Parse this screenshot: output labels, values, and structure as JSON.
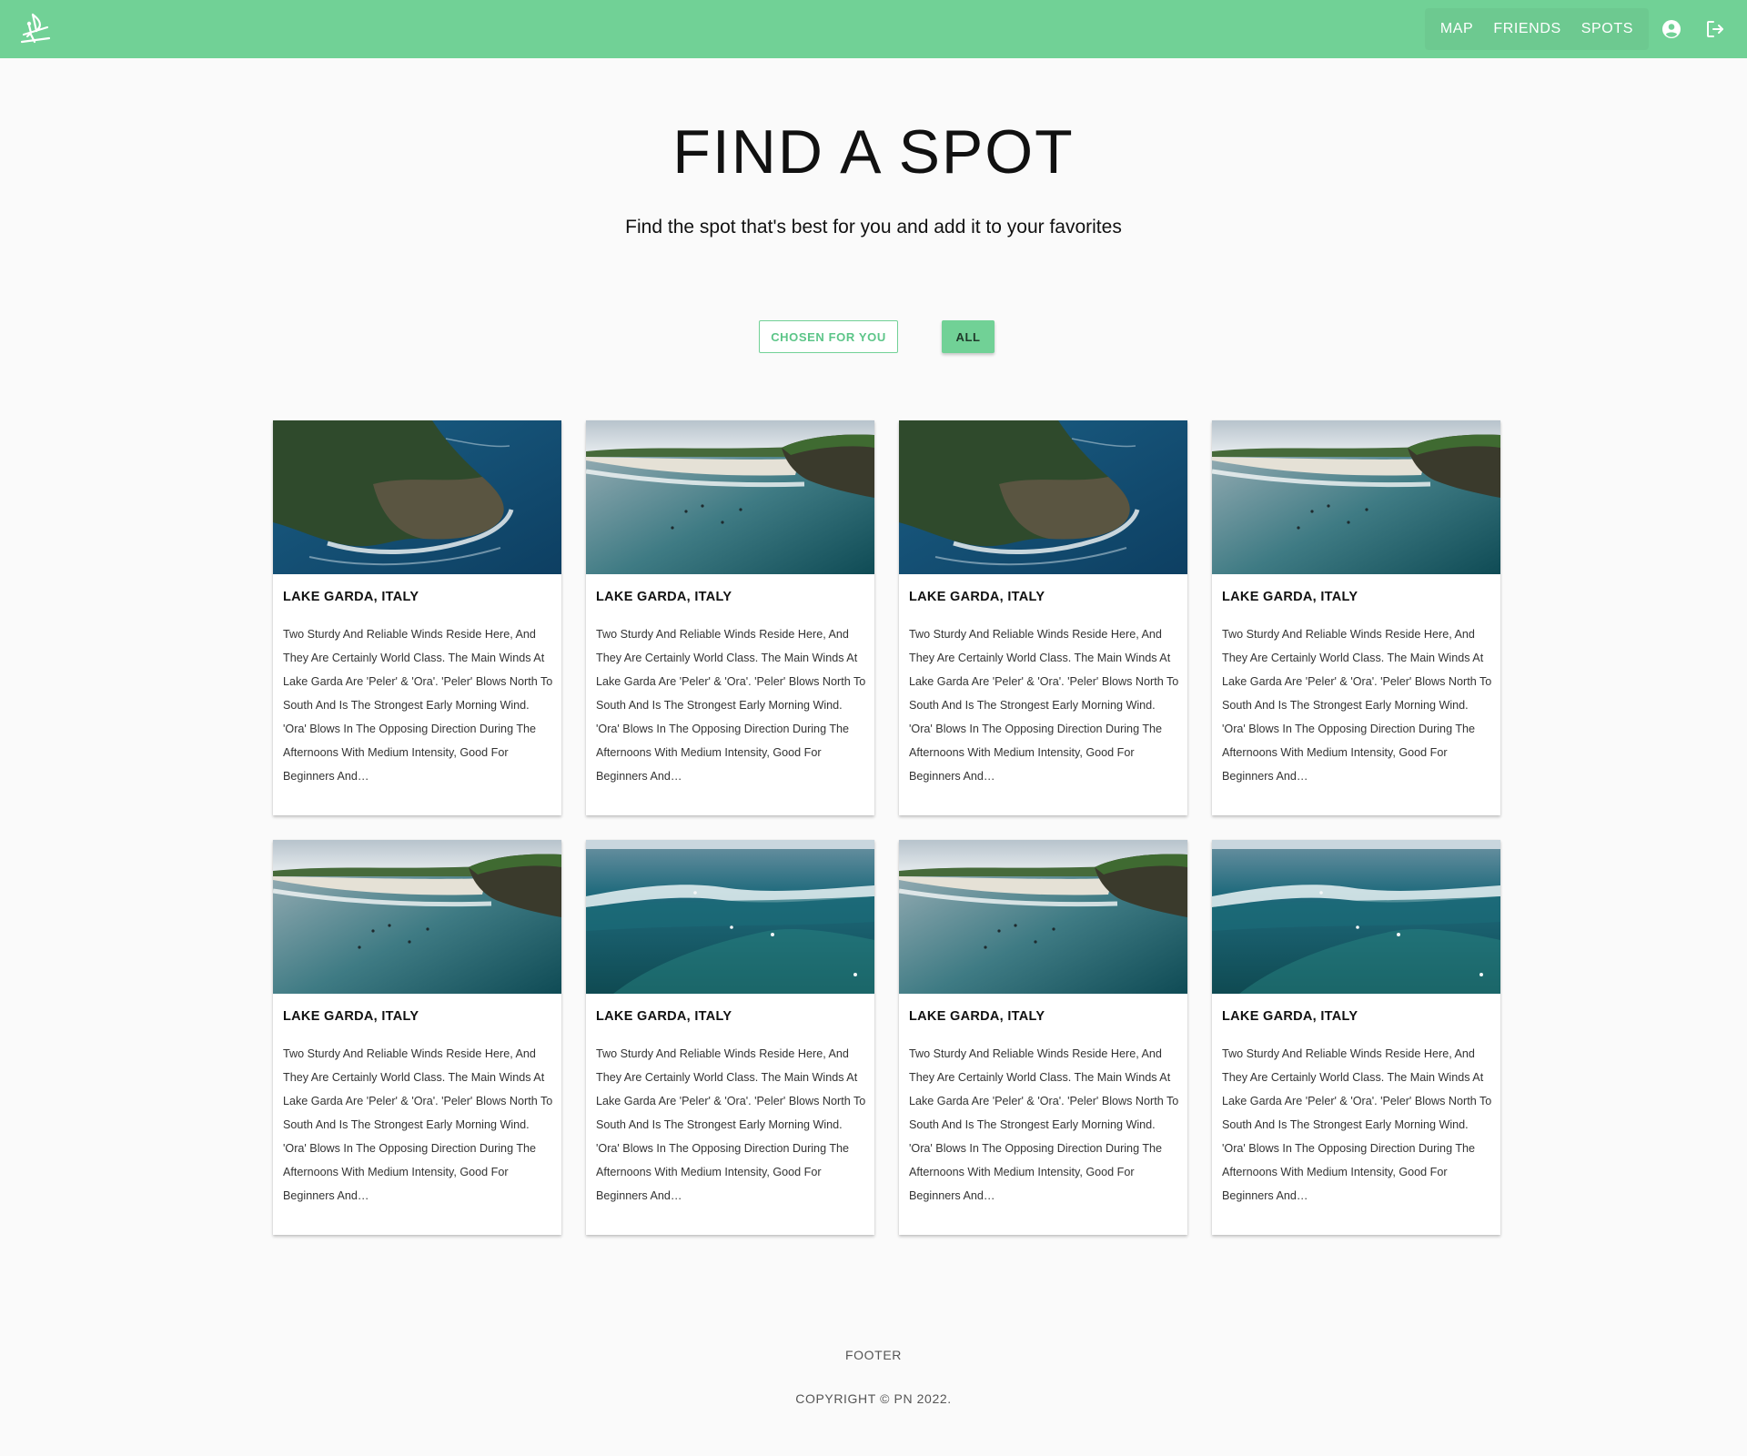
{
  "header": {
    "nav": {
      "map": "MAP",
      "friends": "FRIENDS",
      "spots": "SPOTS"
    },
    "icons": {
      "logo": "windsurfer-logo",
      "account": "account-circle-icon",
      "logout": "logout-icon"
    },
    "color": "#71d196"
  },
  "page": {
    "title": "FIND A SPOT",
    "subtitle": "Find the spot that's best for you and add it to your favorites"
  },
  "filters": {
    "chosen": "CHOSEN FOR YOU",
    "all": "ALL",
    "active": "ALL"
  },
  "spots": [
    {
      "title": "LAKE GARDA, ITALY",
      "image": "cliff-aerial",
      "description": "Two Sturdy And Reliable Winds Reside Here, And They Are Certainly World Class. The Main Winds At Lake Garda Are 'Peler' & 'Ora'. 'Peler' Blows North To South And Is The Strongest Early Morning Wind. 'Ora' Blows In The Opposing Direction During The Afternoons With Medium Intensity, Good For Beginners And…"
    },
    {
      "title": "LAKE GARDA, ITALY",
      "image": "bay-surfers",
      "description": "Two Sturdy And Reliable Winds Reside Here, And They Are Certainly World Class. The Main Winds At Lake Garda Are 'Peler' & 'Ora'. 'Peler' Blows North To South And Is The Strongest Early Morning Wind. 'Ora' Blows In The Opposing Direction During The Afternoons With Medium Intensity, Good For Beginners And…"
    },
    {
      "title": "LAKE GARDA, ITALY",
      "image": "cliff-aerial",
      "description": "Two Sturdy And Reliable Winds Reside Here, And They Are Certainly World Class. The Main Winds At Lake Garda Are 'Peler' & 'Ora'. 'Peler' Blows North To South And Is The Strongest Early Morning Wind. 'Ora' Blows In The Opposing Direction During The Afternoons With Medium Intensity, Good For Beginners And…"
    },
    {
      "title": "LAKE GARDA, ITALY",
      "image": "bay-surfers",
      "description": "Two Sturdy And Reliable Winds Reside Here, And They Are Certainly World Class. The Main Winds At Lake Garda Are 'Peler' & 'Ora'. 'Peler' Blows North To South And Is The Strongest Early Morning Wind. 'Ora' Blows In The Opposing Direction During The Afternoons With Medium Intensity, Good For Beginners And…"
    },
    {
      "title": "LAKE GARDA, ITALY",
      "image": "bay-surfers",
      "description": "Two Sturdy And Reliable Winds Reside Here, And They Are Certainly World Class. The Main Winds At Lake Garda Are 'Peler' & 'Ora'. 'Peler' Blows North To South And Is The Strongest Early Morning Wind. 'Ora' Blows In The Opposing Direction During The Afternoons With Medium Intensity, Good For Beginners And…"
    },
    {
      "title": "LAKE GARDA, ITALY",
      "image": "reef-wave",
      "description": "Two Sturdy And Reliable Winds Reside Here, And They Are Certainly World Class. The Main Winds At Lake Garda Are 'Peler' & 'Ora'. 'Peler' Blows North To South And Is The Strongest Early Morning Wind. 'Ora' Blows In The Opposing Direction During The Afternoons With Medium Intensity, Good For Beginners And…"
    },
    {
      "title": "LAKE GARDA, ITALY",
      "image": "bay-surfers",
      "description": "Two Sturdy And Reliable Winds Reside Here, And They Are Certainly World Class. The Main Winds At Lake Garda Are 'Peler' & 'Ora'. 'Peler' Blows North To South And Is The Strongest Early Morning Wind. 'Ora' Blows In The Opposing Direction During The Afternoons With Medium Intensity, Good For Beginners And…"
    },
    {
      "title": "LAKE GARDA, ITALY",
      "image": "reef-wave",
      "description": "Two Sturdy And Reliable Winds Reside Here, And They Are Certainly World Class. The Main Winds At Lake Garda Are 'Peler' & 'Ora'. 'Peler' Blows North To South And Is The Strongest Early Morning Wind. 'Ora' Blows In The Opposing Direction During The Afternoons With Medium Intensity, Good For Beginners And…"
    }
  ],
  "footer": {
    "label": "FOOTER",
    "copyright": "COPYRIGHT © PN 2022."
  }
}
